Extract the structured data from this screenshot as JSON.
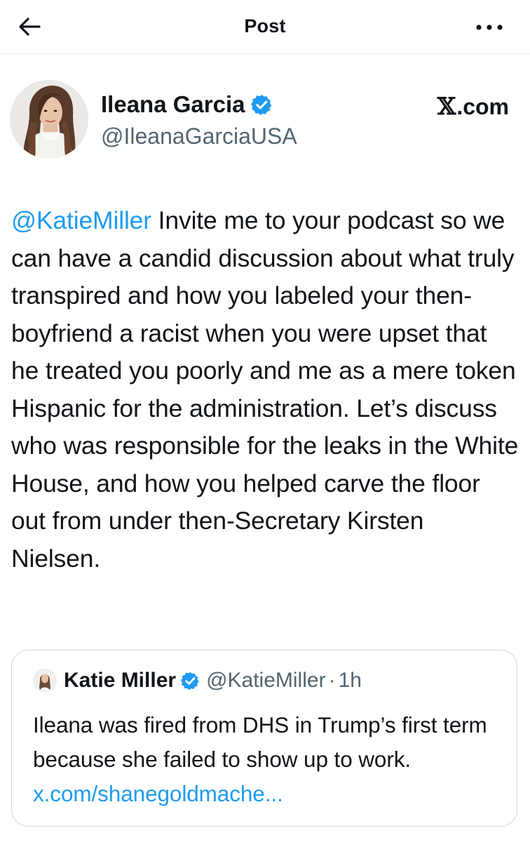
{
  "header": {
    "title": "Post"
  },
  "author": {
    "display_name": "Ileana Garcia",
    "handle": "@IleanaGarciaUSA",
    "verified": true
  },
  "brand": {
    "x_glyph": "𝕏",
    "text": ".com"
  },
  "post": {
    "mention": "@KatieMiller",
    "text": " Invite me to your podcast so we can have a candid discussion about what truly transpired and how you labeled your then-boyfriend a racist when you were upset that he treated you poorly and me as a mere token Hispanic for the administration. Let’s discuss who was responsible for the leaks in the White House, and how you helped carve the floor out from under then-Secretary Kirsten Nielsen."
  },
  "quote": {
    "display_name": "Katie Miller",
    "handle": "@KatieMiller",
    "separator": "·",
    "time": "1h",
    "text": "Ileana was fired from DHS in Trump’s first term because she failed to show up to work. ",
    "link": "x.com/shanegoldmache..."
  },
  "colors": {
    "accent": "#1d9bf0",
    "text": "#0f1419",
    "secondary": "#536471",
    "border": "#cfd9de"
  },
  "icons": {
    "back": "arrow-left-icon",
    "more": "more-horizontal-icon",
    "verified": "verified-badge-icon"
  }
}
